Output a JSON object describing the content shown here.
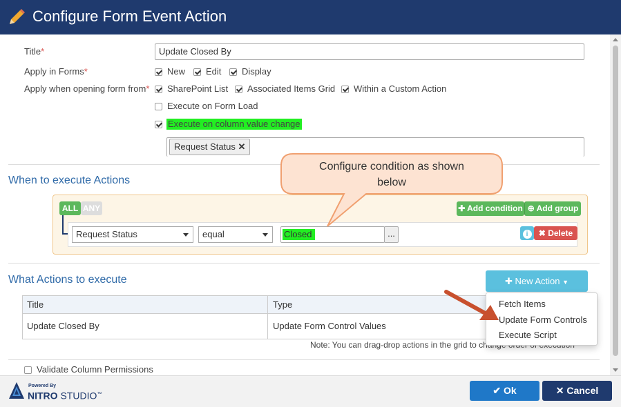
{
  "dialog": {
    "title": "Configure Form Event Action"
  },
  "form": {
    "title_label": "Title",
    "title_value": "Update Closed By",
    "apply_in_forms_label": "Apply in Forms",
    "apply_forms": [
      {
        "label": "New",
        "checked": true
      },
      {
        "label": "Edit",
        "checked": true
      },
      {
        "label": "Display",
        "checked": true
      }
    ],
    "apply_when_label": "Apply when opening form from",
    "apply_when": [
      {
        "label": "SharePoint List",
        "checked": true
      },
      {
        "label": "Associated Items Grid",
        "checked": true
      },
      {
        "label": "Within a Custom Action",
        "checked": true
      }
    ],
    "execute_on_load_label": "Execute on Form Load",
    "execute_on_column_change_label": "Execute on column value change",
    "column_tag": "Request Status",
    "required_mark": "*"
  },
  "conditions": {
    "heading": "When to execute Actions",
    "all_label": "ALL",
    "any_label": "ANY",
    "add_condition_label": "Add condition",
    "add_group_label": "Add group",
    "field_value": "Request Status",
    "operator_value": "equal",
    "compare_value": "Closed",
    "ellipsis": "...",
    "delete_label": "Delete",
    "info_glyph": "i"
  },
  "callout": {
    "line1": "Configure condition as shown",
    "line2": "below"
  },
  "actions": {
    "heading": "What Actions to execute",
    "new_action_label": "New Action",
    "columns": [
      "Title",
      "Type"
    ],
    "rows": [
      {
        "title": "Update Closed By",
        "type": "Update Form Control Values"
      }
    ],
    "note": "Note: You can drag-drop actions in the grid to change order of execution",
    "menu": [
      "Fetch Items",
      "Update Form Controls",
      "Execute Script"
    ]
  },
  "validate_label": "Validate Column Permissions",
  "footer": {
    "powered_by": "Powered By",
    "brand_a": "NITRO",
    "brand_b": "STUDIO",
    "tm": "™",
    "ok_label": "Ok",
    "cancel_label": "Cancel"
  },
  "colors": {
    "title_bar": "#1f3a6e",
    "highlight": "#22ee22",
    "section_heading": "#2f6aa8",
    "add_button": "#5cb85c",
    "delete_button": "#d9534f",
    "info_button": "#5bc0de",
    "new_action_button": "#5bc0de",
    "ok_button": "#1f78c8",
    "cancel_button": "#1f3a6e",
    "arrow": "#c8502e",
    "callout_fill": "#fde3d2",
    "callout_stroke": "#f0a070"
  }
}
